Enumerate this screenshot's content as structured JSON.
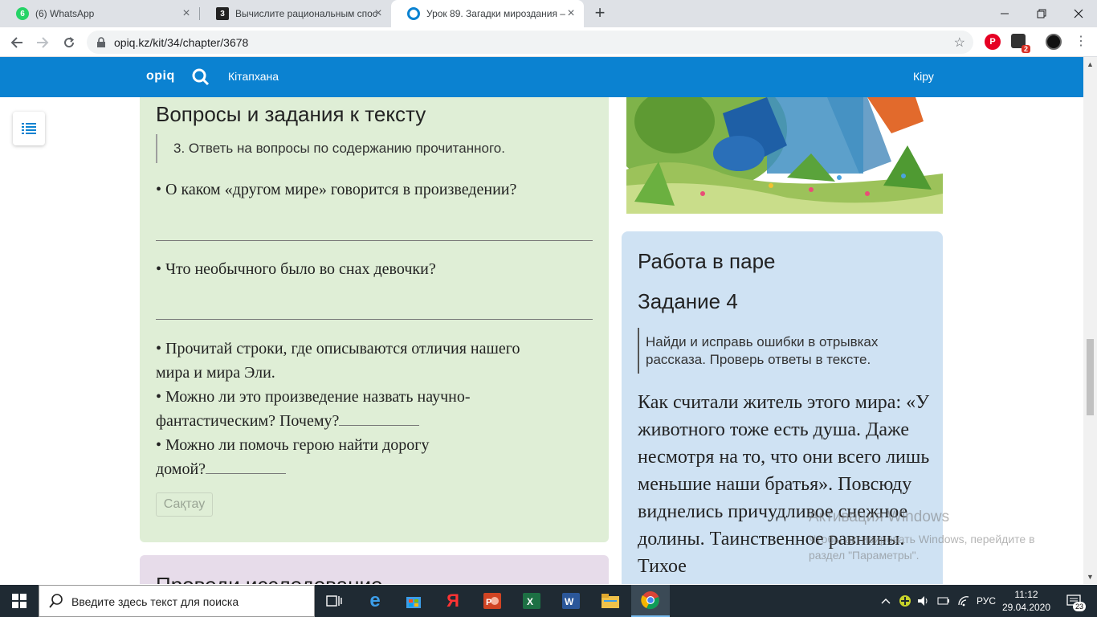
{
  "browser": {
    "tabs": [
      {
        "title": "(6) WhatsApp",
        "favicon": "whatsapp-icon",
        "badge": "6",
        "color": "#25d366"
      },
      {
        "title": "Вычислите рациональным спос",
        "favicon": "znanija-icon",
        "badge": "3",
        "color": "#222222"
      },
      {
        "title": "Урок 89. Загадки мироздания –",
        "favicon": "opiq-icon",
        "badge": "",
        "color": "#0b82d1"
      }
    ],
    "active_tab": 2,
    "url": "opiq.kz/kit/34/chapter/3678",
    "extensions": [
      {
        "name": "pinterest-icon",
        "color": "#e60023"
      },
      {
        "name": "extension-icon",
        "badge": "2",
        "color": "#333333"
      },
      {
        "name": "profile-avatar",
        "color": "#111111"
      }
    ]
  },
  "site": {
    "logo": "opiq",
    "library": "Кітапхана",
    "login": "Кіру",
    "brand_color": "#0b82d1"
  },
  "green_card": {
    "title": "Вопросы и задания к тексту",
    "instruction": "3. Ответь на вопросы по содержанию прочитанного.",
    "q1": "• О каком «другом мире» говорится в произведении?",
    "q2": "• Что необычного было во снах девочки?",
    "q3_line1": "• Прочитай строки, где описываются отличия нашего",
    "q3_line2": "мира и мира Эли.",
    "q4_line1": "• Можно ли это произведение назвать научно-",
    "q4_line2": "фантастическим? Почему?",
    "q5_line1": "• Можно ли помочь герою найти дорогу",
    "q5_line2": "домой?",
    "save": "Сақтау",
    "bg": "#dfeed6"
  },
  "purple_card": {
    "title": "Проведи исследование",
    "bg": "#e7dcea"
  },
  "blue_card": {
    "title1": "Работа в паре",
    "title2": "Задание 4",
    "instruction": "Найди и исправь ошибки в отрывках рассказа. Проверь ответы в тексте.",
    "text": "Как считали житель этого мира: «У животного тоже есть душа. Даже несмотря на то, что они всего лишь меньшие наши братья». Повсюду виднелись причудливое снежное долины. Таинственное равнины. Тихое",
    "bg": "#cfe2f3"
  },
  "watermark": {
    "line1": "Активация Windows",
    "line2": "Чтобы активировать Windows, перейдите в раздел \"Параметры\"."
  },
  "taskbar": {
    "search_placeholder": "Введите здесь текст для поиска",
    "apps": [
      "task-view-icon",
      "edge-icon",
      "store-icon",
      "yandex-icon",
      "powerpoint-icon",
      "excel-icon",
      "word-icon",
      "explorer-icon",
      "chrome-icon"
    ],
    "language": "РУС",
    "time": "11:12",
    "date": "29.04.2020",
    "notifications": "23"
  }
}
